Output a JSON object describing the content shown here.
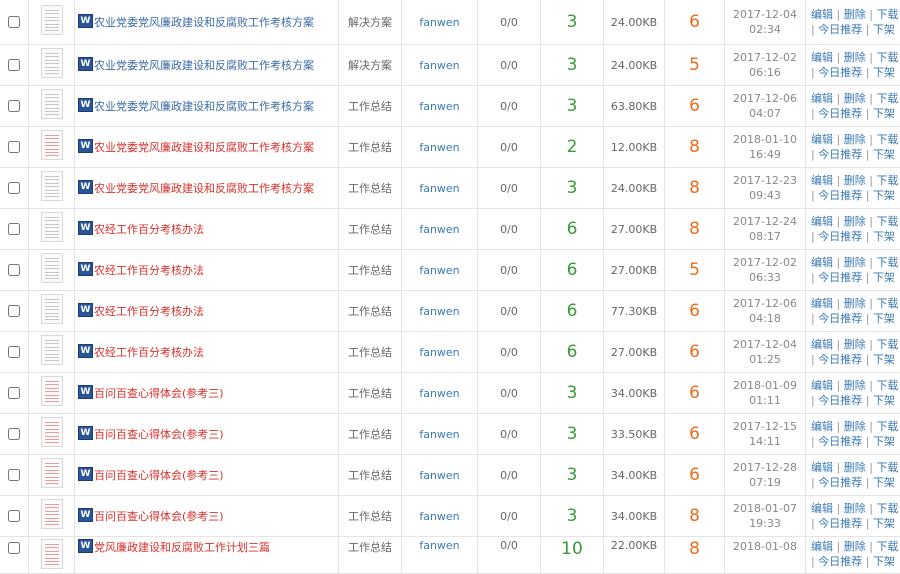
{
  "rows": [
    {
      "title_blue": "农业党委党风廉政建设和反腐败工作考核方案",
      "title_red": "",
      "thumb": "gray",
      "category": "解决方案",
      "user": "fanwen",
      "count": "0/0",
      "score": "3",
      "size": "24.00KB",
      "points": "6",
      "date": "2017-12-04",
      "time": "02:34"
    },
    {
      "title_blue": "农业党委党风廉政建设和反腐败工作考核方案",
      "title_red": "",
      "thumb": "gray",
      "category": "解决方案",
      "user": "fanwen",
      "count": "0/0",
      "score": "3",
      "size": "24.00KB",
      "points": "5",
      "date": "2017-12-02",
      "time": "06:16"
    },
    {
      "title_blue": "农业党委党风廉政建设和反腐败工作考核方案",
      "title_red": "",
      "thumb": "gray",
      "category": "工作总结",
      "user": "fanwen",
      "count": "0/0",
      "score": "3",
      "size": "63.80KB",
      "points": "6",
      "date": "2017-12-06",
      "time": "04:07"
    },
    {
      "title_blue": "",
      "title_red": "农业党委党风廉政建设和反腐败工作考核方案",
      "thumb": "red",
      "category": "工作总结",
      "user": "fanwen",
      "count": "0/0",
      "score": "2",
      "size": "12.00KB",
      "points": "8",
      "date": "2018-01-10",
      "time": "16:49"
    },
    {
      "title_blue": "",
      "title_red": "农业党委党风廉政建设和反腐败工作考核方案",
      "thumb": "gray",
      "category": "工作总结",
      "user": "fanwen",
      "count": "0/0",
      "score": "3",
      "size": "24.00KB",
      "points": "8",
      "date": "2017-12-23",
      "time": "09:43"
    },
    {
      "title_blue": "",
      "title_red": "农经工作百分考核办法",
      "thumb": "gray",
      "category": "工作总结",
      "user": "fanwen",
      "count": "0/0",
      "score": "6",
      "size": "27.00KB",
      "points": "8",
      "date": "2017-12-24",
      "time": "08:17"
    },
    {
      "title_blue": "",
      "title_red": "农经工作百分考核办法",
      "thumb": "gray",
      "category": "工作总结",
      "user": "fanwen",
      "count": "0/0",
      "score": "6",
      "size": "27.00KB",
      "points": "5",
      "date": "2017-12-02",
      "time": "06:33"
    },
    {
      "title_blue": "",
      "title_red": "农经工作百分考核办法",
      "thumb": "gray",
      "category": "工作总结",
      "user": "fanwen",
      "count": "0/0",
      "score": "6",
      "size": "77.30KB",
      "points": "6",
      "date": "2017-12-06",
      "time": "04:18"
    },
    {
      "title_blue": "",
      "title_red": "农经工作百分考核办法",
      "thumb": "gray",
      "category": "工作总结",
      "user": "fanwen",
      "count": "0/0",
      "score": "6",
      "size": "27.00KB",
      "points": "6",
      "date": "2017-12-04",
      "time": "01:25"
    },
    {
      "title_blue": "",
      "title_red": "百问百查心得体会(参考三)",
      "thumb": "red",
      "category": "工作总结",
      "user": "fanwen",
      "count": "0/0",
      "score": "3",
      "size": "34.00KB",
      "points": "6",
      "date": "2018-01-09",
      "time": "01:11"
    },
    {
      "title_blue": "",
      "title_red": "百问百查心得体会(参考三)",
      "thumb": "red",
      "category": "工作总结",
      "user": "fanwen",
      "count": "0/0",
      "score": "3",
      "size": "33.50KB",
      "points": "6",
      "date": "2017-12-15",
      "time": "14:11"
    },
    {
      "title_blue": "",
      "title_red": "百问百查心得体会(参考三)",
      "thumb": "red",
      "category": "工作总结",
      "user": "fanwen",
      "count": "0/0",
      "score": "3",
      "size": "34.00KB",
      "points": "6",
      "date": "2017-12-28",
      "time": "07:19"
    },
    {
      "title_blue": "",
      "title_red": "百问百查心得体会(参考三)",
      "thumb": "red",
      "category": "工作总结",
      "user": "fanwen",
      "count": "0/0",
      "score": "3",
      "size": "34.00KB",
      "points": "8",
      "date": "2018-01-07",
      "time": "19:33"
    },
    {
      "title_blue": "",
      "title_red": "党风廉政建设和反腐败工作计划三篇",
      "thumb": "red",
      "category": "工作总结",
      "user": "fanwen",
      "count": "0/0",
      "score": "10",
      "size": "22.00KB",
      "points": "8",
      "date": "2018-01-08",
      "time": ""
    }
  ],
  "word_icon_letter": "W",
  "actions": {
    "edit": "编辑",
    "delete": "删除",
    "download": "下载",
    "recommend": "今日推荐",
    "shelf": "下架"
  },
  "colors": {
    "link": "#3a7ab5",
    "title_red": "#d9302c",
    "score_green": "#3a9a3a",
    "points_orange": "#ef6b1a"
  }
}
